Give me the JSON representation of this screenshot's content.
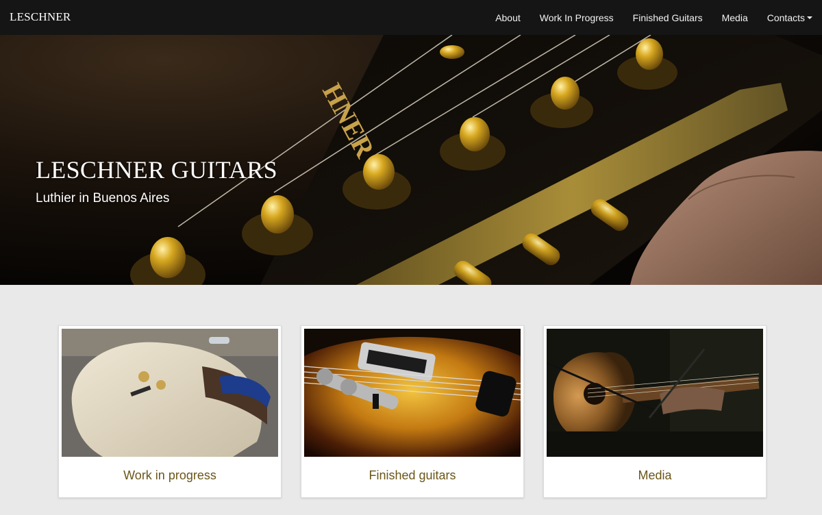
{
  "brand": "LESCHNER",
  "nav": {
    "items": [
      {
        "label": "About"
      },
      {
        "label": "Work In Progress"
      },
      {
        "label": "Finished Guitars"
      },
      {
        "label": "Media"
      },
      {
        "label": "Contacts"
      }
    ]
  },
  "hero": {
    "title": "LESCHNER GUITARS",
    "subtitle": "Luthier in Buenos Aires",
    "headstock_text": "HNER"
  },
  "cards": [
    {
      "label": "Work in progress"
    },
    {
      "label": "Finished guitars"
    },
    {
      "label": "Media"
    }
  ],
  "colors": {
    "navbar_bg": "#151515",
    "page_bg": "#e9e9e9",
    "card_label": "#6b5518",
    "gold": "#c9a033"
  }
}
